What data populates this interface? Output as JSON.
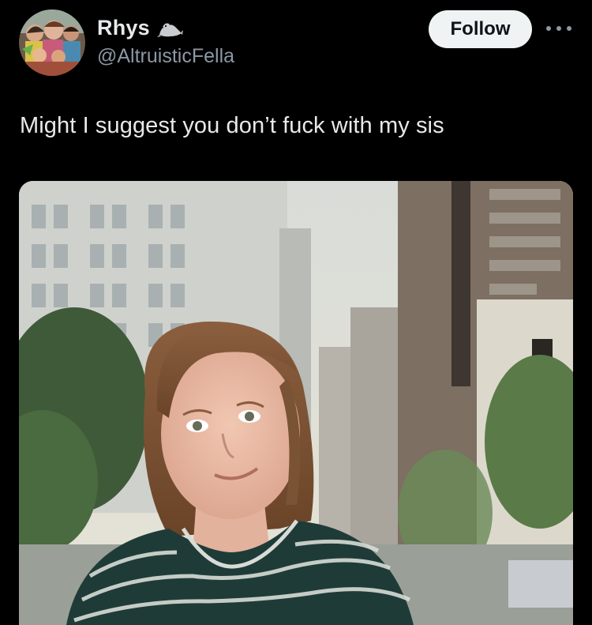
{
  "author": {
    "display_name": "Rhys",
    "display_name_emoji": "seal-icon",
    "handle": "@AltruisticFella",
    "avatar": "avatar"
  },
  "actions": {
    "follow_label": "Follow",
    "more_icon": "more-horizontal-icon"
  },
  "tweet": {
    "text": "Might I suggest you don’t fuck with my sis"
  },
  "media": {
    "type": "photo"
  },
  "colors": {
    "background": "#000000",
    "text_primary": "#e7e9ea",
    "text_secondary": "#8b98a5",
    "follow_bg": "#eff3f4",
    "follow_text": "#0f1419"
  }
}
